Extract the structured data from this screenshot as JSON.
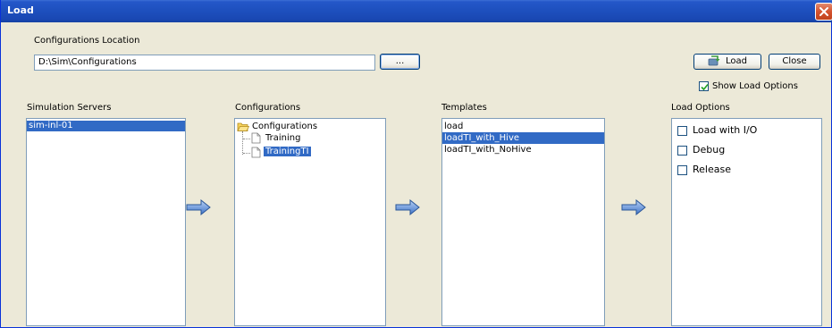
{
  "window": {
    "title": "Load"
  },
  "config_location": {
    "label": "Configurations Location",
    "path": "D:\\Sim\\Configurations",
    "browse_label": "..."
  },
  "buttons": {
    "load": "Load",
    "close": "Close"
  },
  "show_load_options": {
    "label": "Show Load Options",
    "checked": true
  },
  "panels": {
    "servers": {
      "header": "Simulation Servers",
      "items": [
        "sim-inl-01"
      ]
    },
    "configurations": {
      "header": "Configurations",
      "root": "Configurations",
      "children": [
        "Training",
        "TrainingTI"
      ]
    },
    "templates": {
      "header": "Templates",
      "items": [
        "load",
        "loadTI_with_Hive",
        "loadTI_with_NoHive"
      ]
    },
    "load_options": {
      "header": "Load Options",
      "items": [
        {
          "label": "Load with I/O",
          "checked": false
        },
        {
          "label": "Debug",
          "checked": false
        },
        {
          "label": "Release",
          "checked": false
        }
      ]
    }
  },
  "colors": {
    "title_bar": "#1d4fbd",
    "selection": "#316ac5",
    "dialog_bg": "#ece9d8"
  }
}
